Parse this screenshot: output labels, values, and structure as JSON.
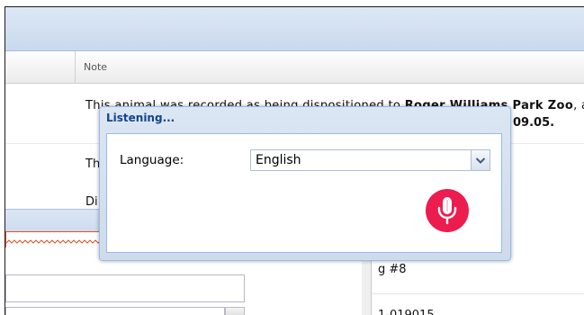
{
  "grid": {
    "header": {
      "note_column": "Note"
    },
    "rows": [
      {
        "note_before": "This animal was recorded as being dispositioned to ",
        "note_bold": "Roger Williams Park Zoo",
        "note_after": ", a",
        "note_line2": "09.05."
      },
      {
        "note_fragment": "Th"
      },
      {
        "note_fragment": "Di"
      }
    ]
  },
  "side_grid": {
    "rows": [
      {
        "fragment": "g #8"
      },
      {
        "fragment": "1-019015"
      }
    ]
  },
  "dialog": {
    "title": "Listening...",
    "language_label": "Language:",
    "language_value": "English",
    "trigger_icon": "chevron-down-icon",
    "mic_icon": "microphone-icon"
  },
  "colors": {
    "mic_button": "#ec1c4f",
    "dialog_title": "#15428b",
    "invalid": "#e0502a"
  }
}
